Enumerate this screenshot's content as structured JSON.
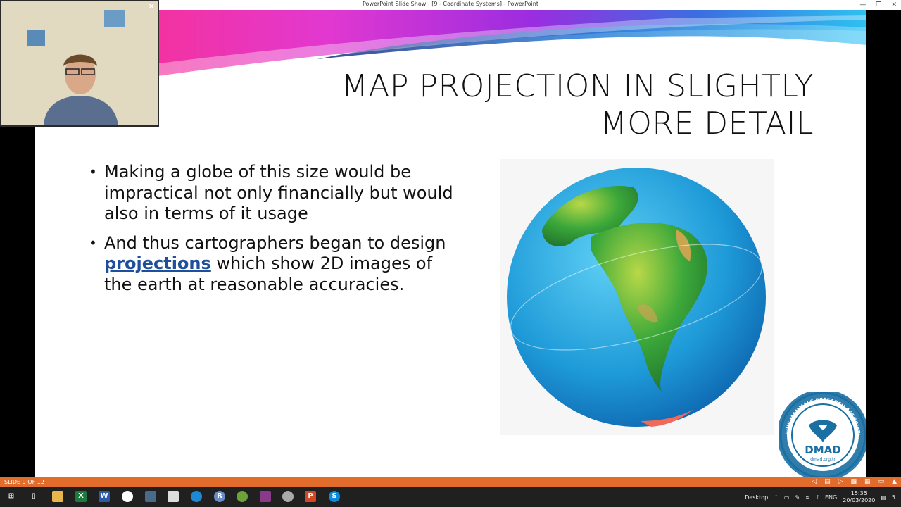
{
  "window": {
    "title": "PowerPoint Slide Show - [9 - Coordinate Systems] - PowerPoint",
    "minimize_icon": "minimize-icon",
    "restore_icon": "restore-icon",
    "close_icon": "close-icon"
  },
  "slide": {
    "title_line1": "MAP PROJECTION IN SLIGHTLY",
    "title_line2": "MORE DETAIL",
    "bullet1": "Making a globe of this size would be impractical not only financially but would also in terms of it usage",
    "bullet2_before": "And thus cartographers began to design ",
    "bullet2_link": "projections",
    "bullet2_after": " which show 2D images of the earth at reasonable accuracies.",
    "logo": {
      "name": "DMAD",
      "ring_text": "MARINE MAMMALS RESEARCH ASSOCIATION",
      "url": "dmad.org.tr",
      "colors": {
        "primary": "#1a6fa3"
      }
    }
  },
  "status_bar": {
    "slide_counter": "SLIDE 9 OF 12",
    "color": "#e16c2c"
  },
  "taskbar": {
    "desktop_label": "Desktop",
    "language": "ENG",
    "time": "15:35",
    "date": "20/03/2020",
    "notification_count": "5"
  },
  "webcam": {
    "close_icon": "close-icon"
  }
}
